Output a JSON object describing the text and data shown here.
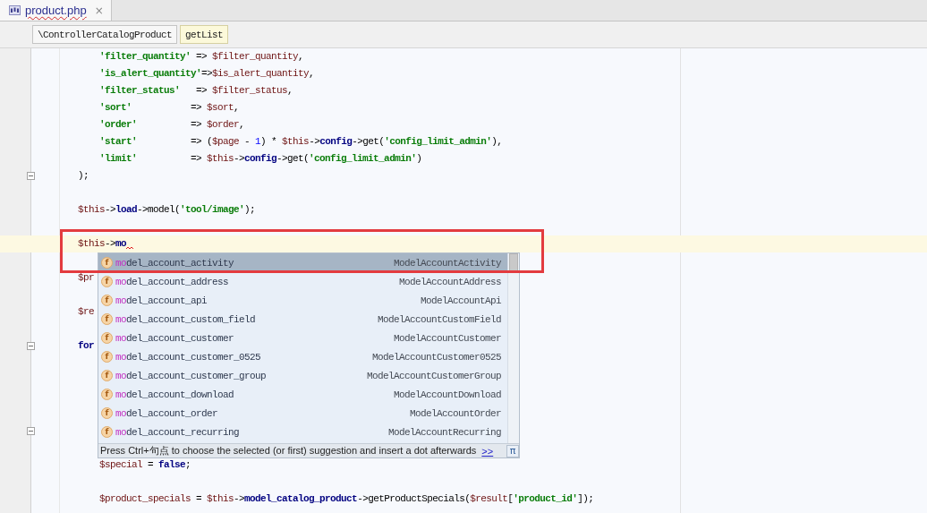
{
  "tabs": [
    {
      "label": "product.php",
      "selected": true,
      "has_error": true,
      "close_glyph": "×"
    }
  ],
  "breadcrumbs": [
    {
      "label": "\\ControllerCatalogProduct",
      "selected": false
    },
    {
      "label": "getList",
      "selected": true
    }
  ],
  "editor": {
    "lines": [
      {
        "kind": "code",
        "current": false,
        "fold_marker": false,
        "error_mark": false,
        "tokens": [
          {
            "kind": "key",
            "text": "        'filter_quantity'"
          },
          {
            "kind": "plain",
            "text": " => "
          },
          {
            "kind": "var",
            "text": "$filter_quantity"
          },
          {
            "kind": "plain",
            "text": ","
          }
        ]
      },
      {
        "kind": "code",
        "current": false,
        "fold_marker": false,
        "error_mark": false,
        "tokens": [
          {
            "kind": "key",
            "text": "        'is_alert_quantity'"
          },
          {
            "kind": "plain",
            "text": "=>"
          },
          {
            "kind": "var",
            "text": "$is_alert_quantity"
          },
          {
            "kind": "plain",
            "text": ","
          }
        ]
      },
      {
        "kind": "code",
        "current": false,
        "fold_marker": false,
        "error_mark": false,
        "tokens": [
          {
            "kind": "key",
            "text": "        'filter_status'"
          },
          {
            "kind": "plain",
            "text": "   => "
          },
          {
            "kind": "var",
            "text": "$filter_status"
          },
          {
            "kind": "plain",
            "text": ","
          }
        ]
      },
      {
        "kind": "code",
        "current": false,
        "fold_marker": false,
        "error_mark": false,
        "tokens": [
          {
            "kind": "key",
            "text": "        'sort'"
          },
          {
            "kind": "plain",
            "text": "           => "
          },
          {
            "kind": "var",
            "text": "$sort"
          },
          {
            "kind": "plain",
            "text": ","
          }
        ]
      },
      {
        "kind": "code",
        "current": false,
        "fold_marker": false,
        "error_mark": false,
        "tokens": [
          {
            "kind": "key",
            "text": "        'order'"
          },
          {
            "kind": "plain",
            "text": "          => "
          },
          {
            "kind": "var",
            "text": "$order"
          },
          {
            "kind": "plain",
            "text": ","
          }
        ]
      },
      {
        "kind": "code",
        "current": false,
        "fold_marker": false,
        "error_mark": false,
        "tokens": [
          {
            "kind": "key",
            "text": "        'start'"
          },
          {
            "kind": "plain",
            "text": "          => ("
          },
          {
            "kind": "var",
            "text": "$page"
          },
          {
            "kind": "plain",
            "text": " - "
          },
          {
            "kind": "num",
            "text": "1"
          },
          {
            "kind": "plain",
            "text": ") * "
          },
          {
            "kind": "var",
            "text": "$this"
          },
          {
            "kind": "plain",
            "text": "->"
          },
          {
            "kind": "member",
            "text": "config"
          },
          {
            "kind": "plain",
            "text": "->get("
          },
          {
            "kind": "key",
            "text": "'config_limit_admin'"
          },
          {
            "kind": "plain",
            "text": "),"
          }
        ]
      },
      {
        "kind": "code",
        "current": false,
        "fold_marker": false,
        "error_mark": false,
        "tokens": [
          {
            "kind": "key",
            "text": "        'limit'"
          },
          {
            "kind": "plain",
            "text": "          => "
          },
          {
            "kind": "var",
            "text": "$this"
          },
          {
            "kind": "plain",
            "text": "->"
          },
          {
            "kind": "member",
            "text": "config"
          },
          {
            "kind": "plain",
            "text": "->get("
          },
          {
            "kind": "key",
            "text": "'config_limit_admin'"
          },
          {
            "kind": "plain",
            "text": ")"
          }
        ]
      },
      {
        "kind": "code",
        "current": false,
        "fold_marker": true,
        "error_mark": false,
        "tokens": [
          {
            "kind": "plain",
            "text": "    );"
          }
        ]
      },
      {
        "kind": "blank",
        "current": false,
        "fold_marker": false,
        "error_mark": false
      },
      {
        "kind": "code",
        "current": false,
        "fold_marker": false,
        "error_mark": false,
        "tokens": [
          {
            "kind": "var",
            "text": "    $this"
          },
          {
            "kind": "plain",
            "text": "->"
          },
          {
            "kind": "member",
            "text": "load"
          },
          {
            "kind": "plain",
            "text": "->model("
          },
          {
            "kind": "key",
            "text": "'tool/image'"
          },
          {
            "kind": "plain",
            "text": ");"
          }
        ]
      },
      {
        "kind": "blank",
        "current": false,
        "fold_marker": false,
        "error_mark": false
      },
      {
        "kind": "code",
        "current": true,
        "fold_marker": false,
        "error_mark": true,
        "tokens": [
          {
            "kind": "var",
            "text": "    $this"
          },
          {
            "kind": "plain",
            "text": "->"
          },
          {
            "kind": "member",
            "text": "mo"
          }
        ]
      },
      {
        "kind": "blank",
        "current": false,
        "fold_marker": false,
        "error_mark": false
      },
      {
        "kind": "code",
        "current": false,
        "fold_marker": false,
        "error_mark": false,
        "tokens": [
          {
            "kind": "var",
            "text": "    $pr"
          }
        ]
      },
      {
        "kind": "blank",
        "current": false,
        "fold_marker": false,
        "error_mark": false
      },
      {
        "kind": "code",
        "current": false,
        "fold_marker": false,
        "error_mark": false,
        "tokens": [
          {
            "kind": "var",
            "text": "    $re"
          }
        ]
      },
      {
        "kind": "blank",
        "current": false,
        "fold_marker": false,
        "error_mark": false
      },
      {
        "kind": "code",
        "current": false,
        "fold_marker": true,
        "error_mark": false,
        "tokens": [
          {
            "kind": "keyword",
            "text": "    for"
          }
        ]
      },
      {
        "kind": "blank",
        "current": false,
        "fold_marker": false,
        "error_mark": false
      },
      {
        "kind": "blank",
        "current": false,
        "fold_marker": false,
        "error_mark": false
      },
      {
        "kind": "blank",
        "current": false,
        "fold_marker": false,
        "error_mark": false
      },
      {
        "kind": "blank",
        "current": false,
        "fold_marker": false,
        "error_mark": false
      },
      {
        "kind": "blank",
        "current": false,
        "fold_marker": true,
        "error_mark": false
      },
      {
        "kind": "blank",
        "current": false,
        "fold_marker": false,
        "error_mark": false
      },
      {
        "kind": "code",
        "current": false,
        "fold_marker": false,
        "error_mark": false,
        "tokens": [
          {
            "kind": "var",
            "text": "        $special"
          },
          {
            "kind": "plain",
            "text": " = "
          },
          {
            "kind": "keyword",
            "text": "false"
          },
          {
            "kind": "plain",
            "text": ";"
          }
        ]
      },
      {
        "kind": "blank",
        "current": false,
        "fold_marker": false,
        "error_mark": false
      },
      {
        "kind": "code",
        "current": false,
        "fold_marker": false,
        "error_mark": false,
        "tokens": [
          {
            "kind": "var",
            "text": "        $product_specials"
          },
          {
            "kind": "plain",
            "text": " = "
          },
          {
            "kind": "var",
            "text": "$this"
          },
          {
            "kind": "plain",
            "text": "->"
          },
          {
            "kind": "member",
            "text": "model_catalog_product"
          },
          {
            "kind": "plain",
            "text": "->getProductSpecials("
          },
          {
            "kind": "var",
            "text": "$result"
          },
          {
            "kind": "plain",
            "text": "["
          },
          {
            "kind": "key",
            "text": "'product_id'"
          },
          {
            "kind": "plain",
            "text": "]);"
          }
        ]
      }
    ]
  },
  "completion_popup": {
    "items": [
      {
        "icon_letter": "f",
        "match": "mo",
        "rest": "del_account_activity",
        "type": "ModelAccountActivity",
        "selected": true
      },
      {
        "icon_letter": "f",
        "match": "mo",
        "rest": "del_account_address",
        "type": "ModelAccountAddress",
        "selected": false
      },
      {
        "icon_letter": "f",
        "match": "mo",
        "rest": "del_account_api",
        "type": "ModelAccountApi",
        "selected": false
      },
      {
        "icon_letter": "f",
        "match": "mo",
        "rest": "del_account_custom_field",
        "type": "ModelAccountCustomField",
        "selected": false
      },
      {
        "icon_letter": "f",
        "match": "mo",
        "rest": "del_account_customer",
        "type": "ModelAccountCustomer",
        "selected": false
      },
      {
        "icon_letter": "f",
        "match": "mo",
        "rest": "del_account_customer_0525",
        "type": "ModelAccountCustomer0525",
        "selected": false
      },
      {
        "icon_letter": "f",
        "match": "mo",
        "rest": "del_account_customer_group",
        "type": "ModelAccountCustomerGroup",
        "selected": false
      },
      {
        "icon_letter": "f",
        "match": "mo",
        "rest": "del_account_download",
        "type": "ModelAccountDownload",
        "selected": false
      },
      {
        "icon_letter": "f",
        "match": "mo",
        "rest": "del_account_order",
        "type": "ModelAccountOrder",
        "selected": false
      },
      {
        "icon_letter": "f",
        "match": "mo",
        "rest": "del_account_recurring",
        "type": "ModelAccountRecurring",
        "selected": false
      }
    ],
    "hint": {
      "text": "Press Ctrl+句点 to choose the selected (or first) suggestion and insert a dot afterwards",
      "link": ">>",
      "pi_button": "π"
    }
  }
}
